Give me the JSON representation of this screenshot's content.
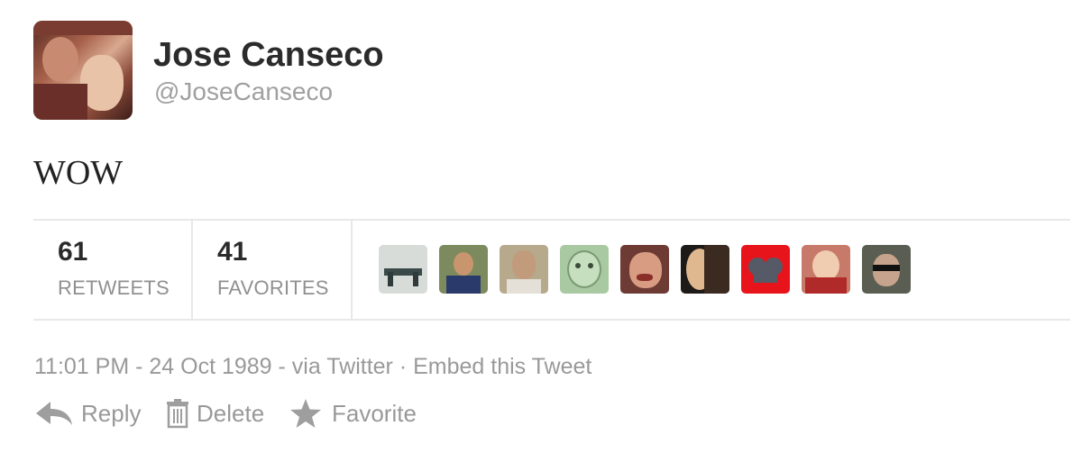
{
  "user": {
    "name": "Jose Canseco",
    "handle": "@JoseCanseco"
  },
  "tweet": {
    "text": "WOW"
  },
  "stats": {
    "retweets_count": "61",
    "retweets_label": "RETWEETS",
    "favorites_count": "41",
    "favorites_label": "FAVORITES"
  },
  "meta": {
    "timestamp": "11:01 PM - 24 Oct 1989",
    "sep1": " - ",
    "via": "via Twitter",
    "sep2": " · ",
    "embed": "Embed this Tweet"
  },
  "actions": {
    "reply": "Reply",
    "delete": "Delete",
    "favorite": "Favorite"
  },
  "icons": [
    "reply-icon",
    "trash-icon",
    "star-icon"
  ],
  "colors": {
    "name": "#2b2b2b",
    "muted": "#999999",
    "divider": "#e8e8e8"
  }
}
